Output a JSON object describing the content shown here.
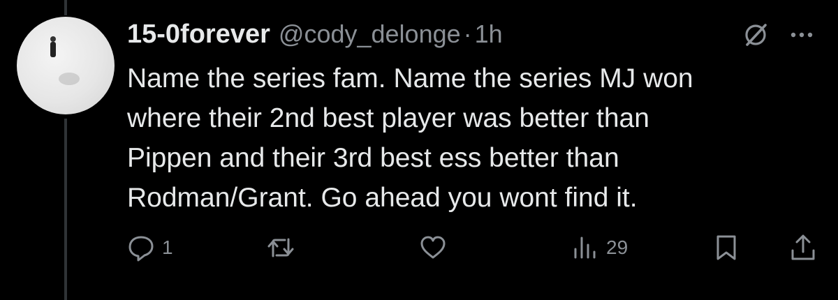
{
  "tweet": {
    "author": {
      "display_name": "15-0forever",
      "handle": "@cody_delonge",
      "separator": "·",
      "time": "1h"
    },
    "text_lines": [
      "Name the series fam. Name the series MJ won",
      "where their 2nd best player was better than",
      "Pippen and their 3rd best ess better than",
      "Rodman/Grant. Go ahead you wont find it."
    ],
    "actions": {
      "replies": "1",
      "retweets": "",
      "likes": "",
      "views": "29"
    },
    "icons": {
      "grok": "grok-icon",
      "more": "more-icon",
      "reply": "reply-icon",
      "retweet": "retweet-icon",
      "like": "heart-icon",
      "views": "views-icon",
      "bookmark": "bookmark-icon",
      "share": "share-icon"
    },
    "colors": {
      "background": "#000000",
      "text": "#e7e9ea",
      "secondary": "#8b9096",
      "thread_line": "#2f3336"
    }
  }
}
